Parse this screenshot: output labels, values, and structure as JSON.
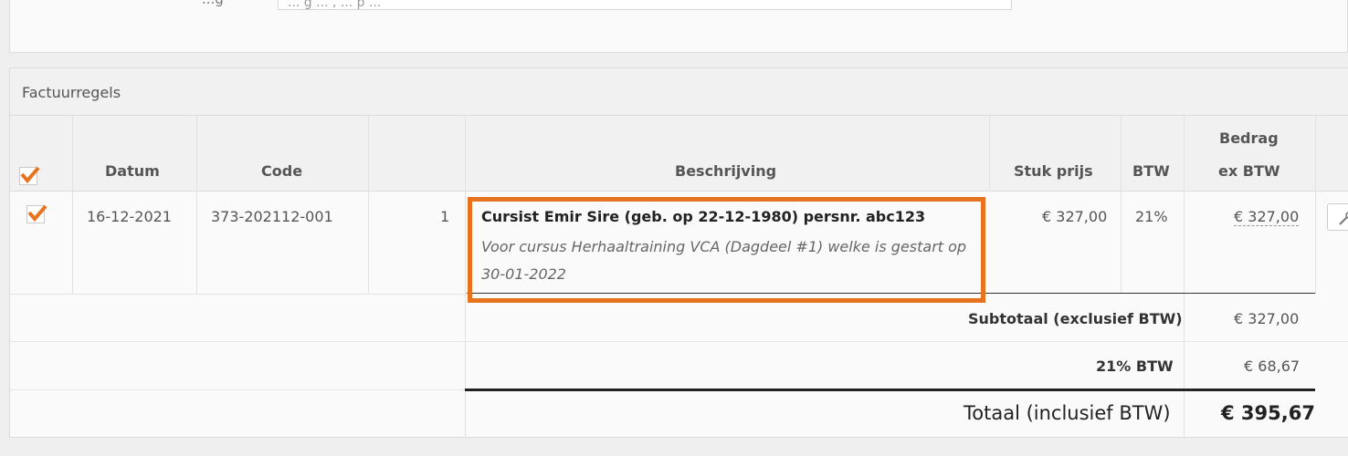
{
  "top": {
    "label": "...g",
    "input_value": "... g ... , ... p ..."
  },
  "panel": {
    "title": "Factuurregels"
  },
  "columns": {
    "datum": "Datum",
    "code": "Code",
    "beschrijving": "Beschrijving",
    "stuk_prijs": "Stuk prijs",
    "btw": "BTW",
    "bedrag_line1": "Bedrag",
    "bedrag_line2": "ex BTW"
  },
  "rows": [
    {
      "checked": true,
      "datum": "16-12-2021",
      "code": "373-202112-001",
      "aantal": "1",
      "description_title": "Cursist Emir Sire (geb. op 22-12-1980) persnr. abc123",
      "description_detail": "Voor cursus Herhaaltraining VCA (Dagdeel #1) welke is gestart op 30-01-2022",
      "stuk_prijs": "€ 327,00",
      "btw": "21%",
      "bedrag": "€ 327,00"
    }
  ],
  "totals": {
    "subtotal_label": "Subtotaal (exclusief BTW)",
    "subtotal_value": "€ 327,00",
    "btw_label": "21% BTW",
    "btw_value": "€ 68,67",
    "total_label": "Totaal (inclusief BTW)",
    "total_value": "€ 395,67"
  },
  "colors": {
    "accent": "#e8731e"
  },
  "icons": {
    "checkbox": "check-icon",
    "edit": "wrench-icon"
  }
}
